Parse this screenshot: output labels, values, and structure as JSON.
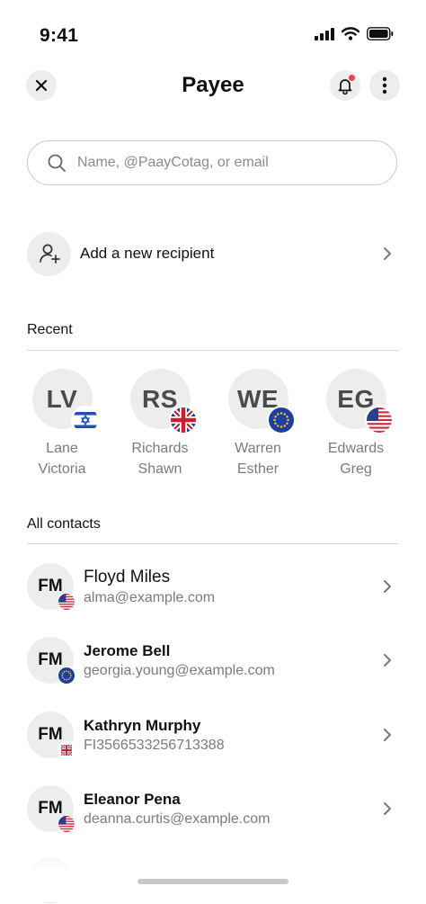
{
  "status_bar": {
    "time": "9:41"
  },
  "header": {
    "title": "Payee"
  },
  "search": {
    "placeholder": "Name, @PaayCotag, or email"
  },
  "add_recipient": {
    "label": "Add a new recipient"
  },
  "recent": {
    "title": "Recent",
    "items": [
      {
        "initials": "LV",
        "first": "Lane",
        "second": "Victoria",
        "flag": "israel"
      },
      {
        "initials": "RS",
        "first": "Richards",
        "second": "Shawn",
        "flag": "uk"
      },
      {
        "initials": "WE",
        "first": "Warren",
        "second": "Esther",
        "flag": "eu"
      },
      {
        "initials": "EG",
        "first": "Edwards",
        "second": "Greg",
        "flag": "usa"
      }
    ]
  },
  "contacts": {
    "title": "All contacts",
    "items": [
      {
        "initials": "FM",
        "name": "Floyd Miles",
        "detail": "alma@example.com",
        "flag": "usa"
      },
      {
        "initials": "FM",
        "name": "Jerome Bell",
        "detail": "georgia.young@example.com",
        "flag": "eu"
      },
      {
        "initials": "FM",
        "name": "Kathryn Murphy",
        "detail": "FI3566533256713388",
        "flag": "uk"
      },
      {
        "initials": "FM",
        "name": "Eleanor Pena",
        "detail": "deanna.curtis@example.com",
        "flag": "usa"
      }
    ]
  },
  "colors": {
    "avatar_bg": "#eceeed",
    "notification_dot": "#e8474a",
    "muted_text": "#7b7b7b"
  }
}
